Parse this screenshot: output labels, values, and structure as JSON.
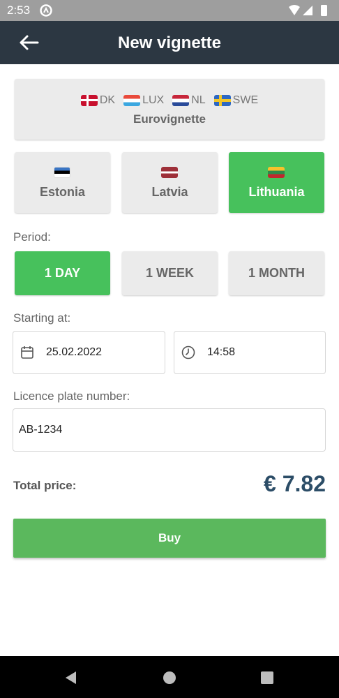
{
  "status_bar": {
    "time": "2:53"
  },
  "header": {
    "title": "New vignette"
  },
  "eurovignette": {
    "countries": [
      "DK",
      "LUX",
      "NL",
      "SWE"
    ],
    "label": "Eurovignette"
  },
  "countries": [
    {
      "name": "Estonia",
      "selected": false
    },
    {
      "name": "Latvia",
      "selected": false
    },
    {
      "name": "Lithuania",
      "selected": true
    }
  ],
  "period": {
    "label": "Period:",
    "options": [
      "1 DAY",
      "1 WEEK",
      "1 MONTH"
    ],
    "selected": "1 DAY"
  },
  "start": {
    "label": "Starting at:",
    "date": "25.02.2022",
    "time": "14:58"
  },
  "plate": {
    "label": "Licence plate number:",
    "value": "AB-1234"
  },
  "total": {
    "label": "Total price:",
    "value": "€ 7.82"
  },
  "buy_label": "Buy",
  "colors": {
    "accent_green": "#47c15c",
    "app_bar": "#2c3742",
    "price": "#2c4d67"
  }
}
